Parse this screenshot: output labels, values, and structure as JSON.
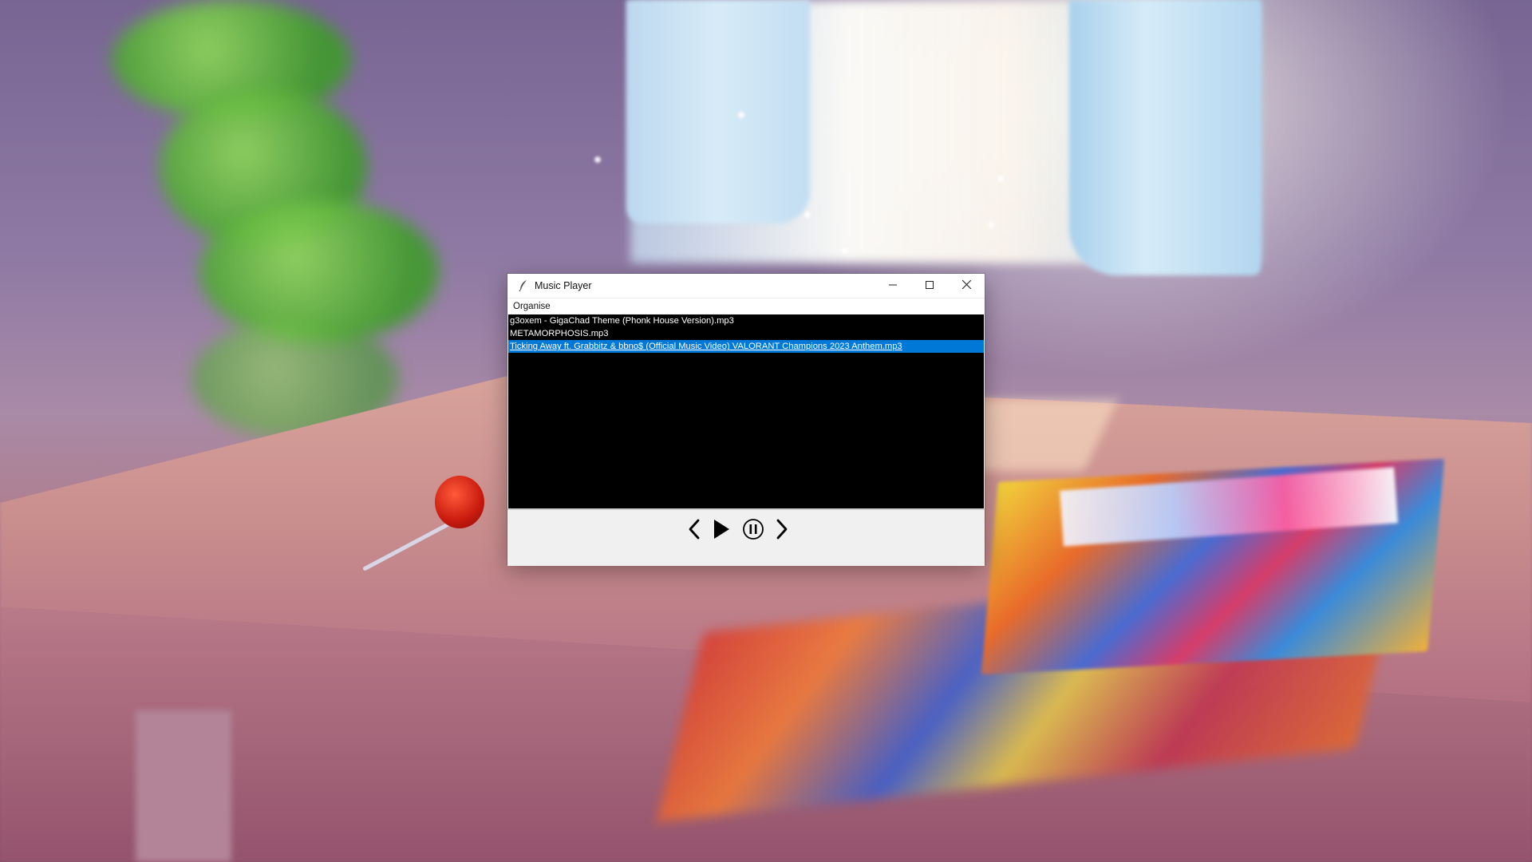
{
  "window": {
    "title": "Music Player",
    "menu": [
      "Organise"
    ],
    "controls": {
      "minimize": "minimize-icon",
      "maximize": "maximize-icon",
      "close": "close-icon"
    }
  },
  "playlist": {
    "tracks": [
      {
        "name": "g3oxem - GigaChad Theme (Phonk House Version).mp3",
        "selected": false
      },
      {
        "name": "METAMORPHOSIS.mp3",
        "selected": false
      },
      {
        "name": "Ticking Away ft. Grabbitz & bbno$ (Official Music Video)  VALORANT Champions 2023 Anthem.mp3",
        "selected": true
      }
    ],
    "background": "#000000",
    "selection_color": "#0078d7"
  },
  "player_controls": [
    {
      "name": "previous",
      "icon": "chevron-left-icon"
    },
    {
      "name": "play",
      "icon": "play-icon"
    },
    {
      "name": "pause",
      "icon": "pause-circle-icon"
    },
    {
      "name": "next",
      "icon": "chevron-right-icon"
    }
  ]
}
